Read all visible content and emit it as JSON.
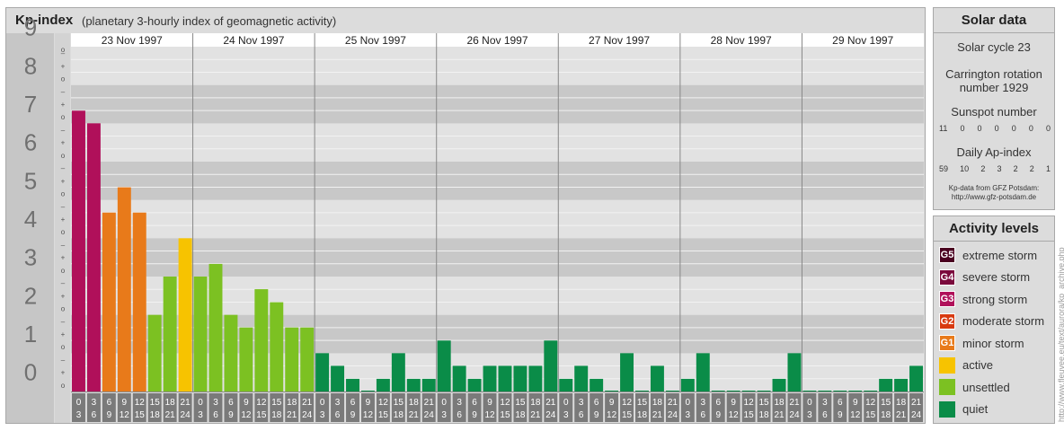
{
  "header": {
    "title": "Kp-index",
    "subtitle": "(planetary 3-hourly index of geomagnetic activity)"
  },
  "chart_data": {
    "type": "bar",
    "title": "Kp-index",
    "subtitle": "(planetary 3-hourly index of geomagnetic activity)",
    "ylim": [
      0,
      9
    ],
    "yticks": [
      "0",
      "1",
      "2",
      "3",
      "4",
      "5",
      "6",
      "7",
      "8",
      "9"
    ],
    "minor_marks": [
      "o",
      "+",
      "–"
    ],
    "days": [
      "23 Nov 1997",
      "24 Nov 1997",
      "25 Nov 1997",
      "26 Nov 1997",
      "27 Nov 1997",
      "28 Nov 1997",
      "29 Nov 1997"
    ],
    "interval_top": [
      "0",
      "3",
      "6",
      "9",
      "12",
      "15",
      "18",
      "21"
    ],
    "interval_bottom": [
      "3",
      "6",
      "9",
      "12",
      "15",
      "18",
      "21",
      "24"
    ],
    "values": [
      7.33,
      7.0,
      4.67,
      5.33,
      4.67,
      2.0,
      3.0,
      4.0,
      3.0,
      3.33,
      2.0,
      1.67,
      2.67,
      2.33,
      1.67,
      1.67,
      1.0,
      0.67,
      0.33,
      0.0,
      0.33,
      1.0,
      0.33,
      0.33,
      1.33,
      0.67,
      0.33,
      0.67,
      0.67,
      0.67,
      0.67,
      1.33,
      0.33,
      0.67,
      0.33,
      0.0,
      1.0,
      0.0,
      0.67,
      0.0,
      0.33,
      1.0,
      0.0,
      0.0,
      0.0,
      0.0,
      0.33,
      1.0,
      0.0,
      0.0,
      0.0,
      0.0,
      0.0,
      0.33,
      0.33,
      0.67
    ],
    "colors": {
      "G5": "#4a0020",
      "G4": "#7a0a3c",
      "G3": "#b0105a",
      "G2": "#d83a10",
      "G1": "#e87a1a",
      "active": "#f7c300",
      "unsettled": "#7cc122",
      "quiet": "#0a8c48"
    },
    "grid": true
  },
  "solar": {
    "title": "Solar data",
    "cycle": "Solar cycle 23",
    "carrington_1": "Carrington rotation",
    "carrington_2": "number 1929",
    "sunspot_label": "Sunspot number",
    "sunspot_values": [
      "11",
      "0",
      "0",
      "0",
      "0",
      "0",
      "0"
    ],
    "ap_label": "Daily Ap-index",
    "ap_values": [
      "59",
      "10",
      "2",
      "3",
      "2",
      "2",
      "1"
    ],
    "source_1": "Kp-data from GFZ Potsdam:",
    "source_2": "http://www.gfz-potsdam.de"
  },
  "activity": {
    "title": "Activity levels",
    "items": [
      {
        "badge": "G5",
        "label": "extreme storm",
        "color": "#4a0020"
      },
      {
        "badge": "G4",
        "label": "severe storm",
        "color": "#7a0a3c"
      },
      {
        "badge": "G3",
        "label": "strong storm",
        "color": "#b0105a"
      },
      {
        "badge": "G2",
        "label": "moderate storm",
        "color": "#d83a10"
      },
      {
        "badge": "G1",
        "label": "minor storm",
        "color": "#e87a1a"
      },
      {
        "badge": "",
        "label": "active",
        "color": "#f7c300"
      },
      {
        "badge": "",
        "label": "unsettled",
        "color": "#7cc122"
      },
      {
        "badge": "",
        "label": "quiet",
        "color": "#0a8c48"
      }
    ]
  },
  "watermark": "http://www.fleuvee.eu/text/aurora/kp_archive.php"
}
